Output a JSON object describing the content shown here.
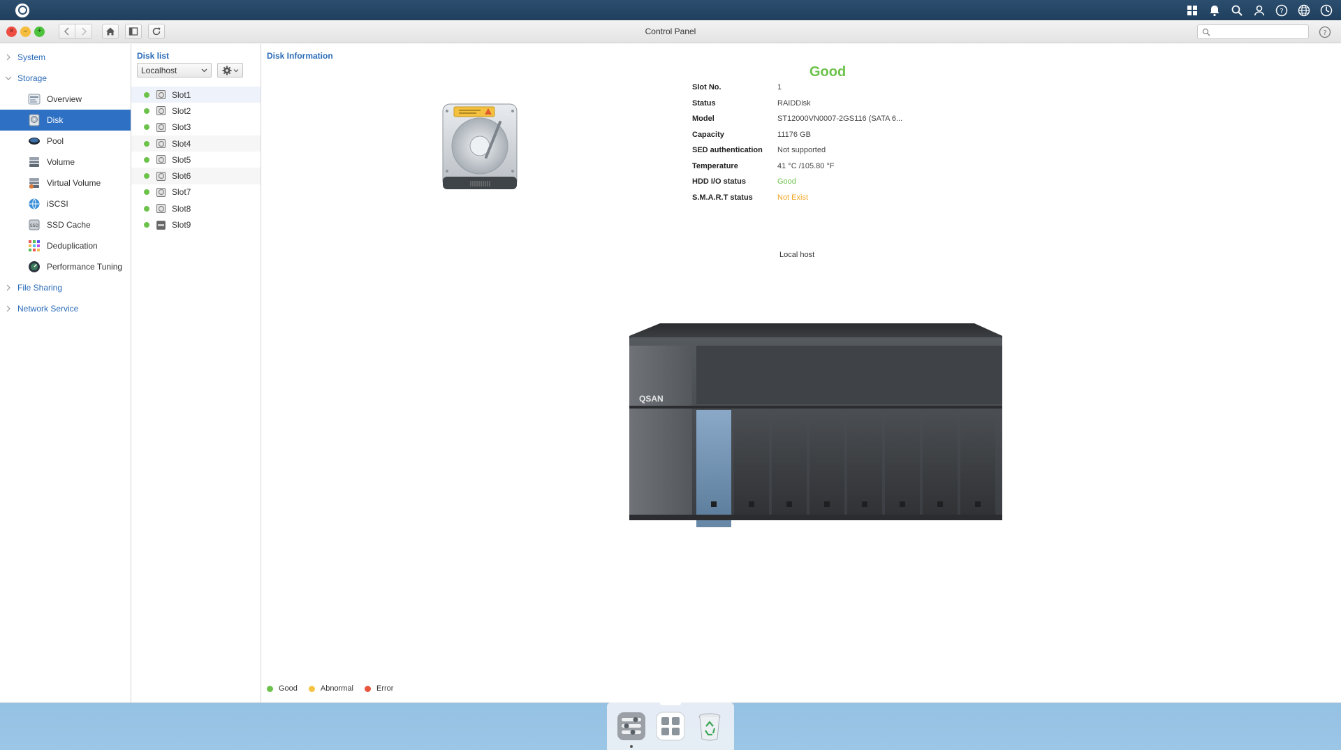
{
  "window": {
    "title": "Control Panel"
  },
  "search": {
    "placeholder": ""
  },
  "sidebar": {
    "sections": [
      {
        "label": "System"
      },
      {
        "label": "Storage"
      },
      {
        "label": "File Sharing"
      },
      {
        "label": "Network Service"
      }
    ],
    "storage_items": [
      {
        "label": "Overview",
        "icon": "overview-icon"
      },
      {
        "label": "Disk",
        "icon": "disk-icon",
        "active": true
      },
      {
        "label": "Pool",
        "icon": "pool-icon"
      },
      {
        "label": "Volume",
        "icon": "volume-icon"
      },
      {
        "label": "Virtual Volume",
        "icon": "virtual-volume-icon"
      },
      {
        "label": "iSCSI",
        "icon": "iscsi-icon"
      },
      {
        "label": "SSD Cache",
        "icon": "ssd-cache-icon"
      },
      {
        "label": "Deduplication",
        "icon": "deduplication-icon"
      },
      {
        "label": "Performance Tuning",
        "icon": "performance-tuning-icon"
      }
    ]
  },
  "disk_list": {
    "heading": "Disk list",
    "host_select": "Localhost",
    "slots": [
      "Slot1",
      "Slot2",
      "Slot3",
      "Slot4",
      "Slot5",
      "Slot6",
      "Slot7",
      "Slot8",
      "Slot9"
    ]
  },
  "disk_info": {
    "heading": "Disk Information",
    "status_big": "Good",
    "rows": [
      {
        "label": "Slot No.",
        "value": "1"
      },
      {
        "label": "Status",
        "value": "RAIDDisk"
      },
      {
        "label": "Model",
        "value": "ST12000VN0007-2GS116 (SATA 6..."
      },
      {
        "label": "Capacity",
        "value": "11176 GB"
      },
      {
        "label": "SED authentication",
        "value": "Not supported"
      },
      {
        "label": "Temperature",
        "value": "41 °C /105.80 °F"
      },
      {
        "label": "HDD I/O status",
        "value": "Good"
      },
      {
        "label": "S.M.A.R.T status",
        "value": "Not Exist"
      }
    ],
    "location": "Local host",
    "nas_brand": "QSAN"
  },
  "legend": [
    {
      "label": "Good",
      "color": "#6cc24a"
    },
    {
      "label": "Abnormal",
      "color": "#f5c342"
    },
    {
      "label": "Error",
      "color": "#e8573d"
    }
  ],
  "colors": {
    "accent": "#2e71c4",
    "good": "#6cc24a",
    "warn": "#f5a623"
  }
}
